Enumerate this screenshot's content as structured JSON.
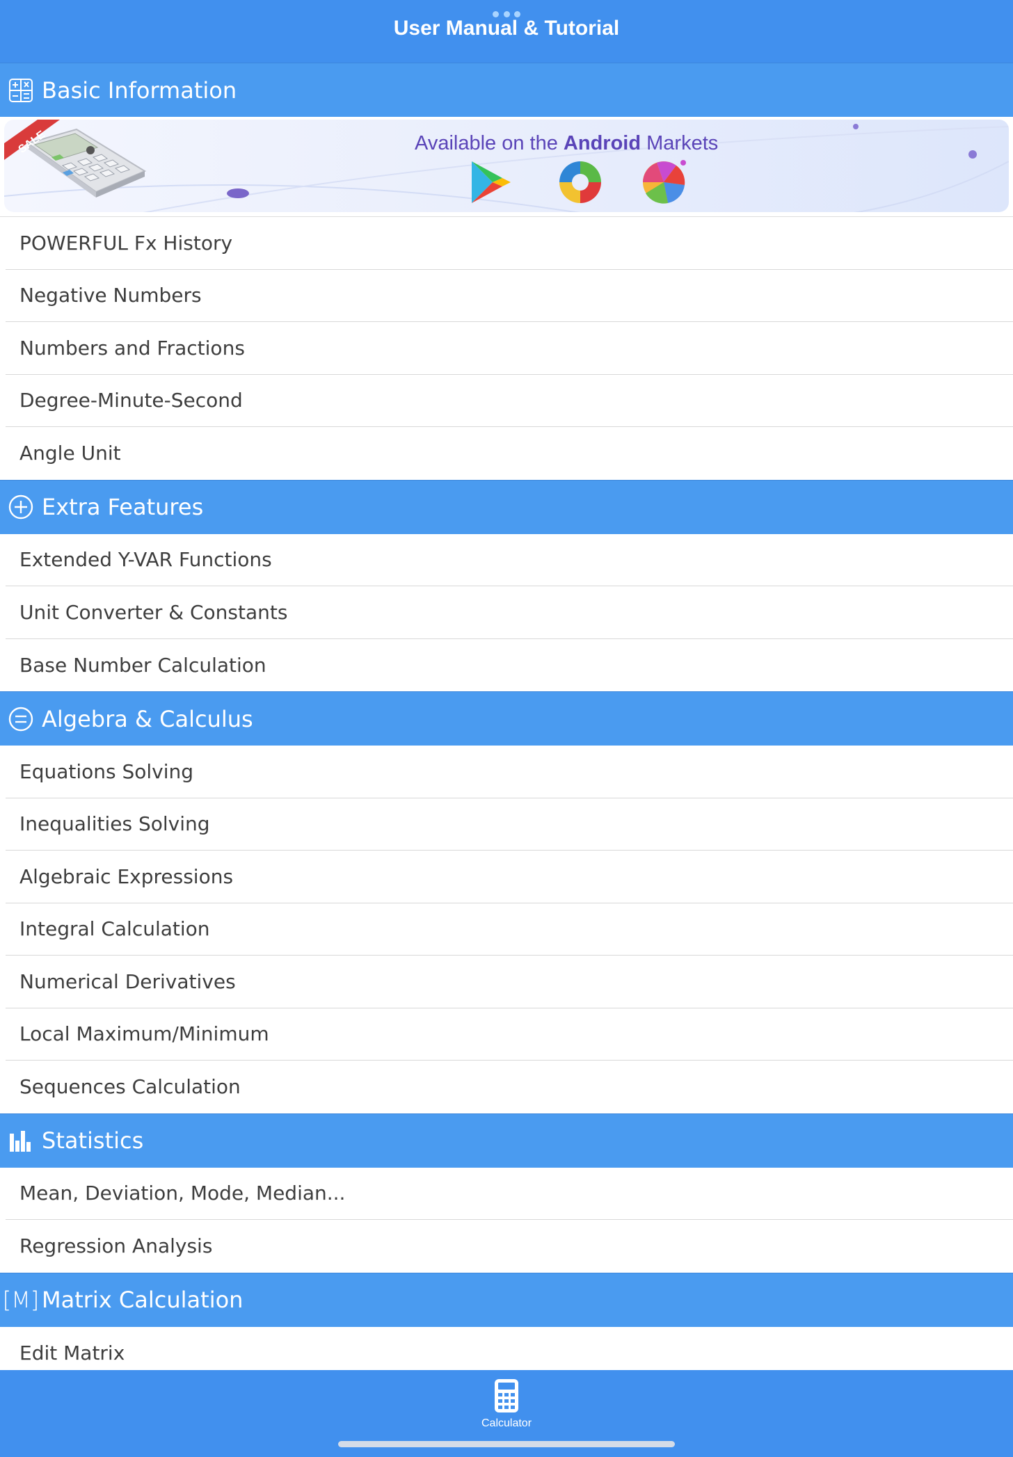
{
  "header": {
    "title": "User Manual & Tutorial"
  },
  "banner": {
    "text_prefix": "Available on the ",
    "text_bold": "Android",
    "text_suffix": " Markets",
    "sale_label": "SALE"
  },
  "sections": [
    {
      "title": "Basic Information",
      "icon": "calculator-grid-icon",
      "items": [
        "POWERFUL Fx History",
        "Negative Numbers",
        "Numbers and Fractions",
        "Degree-Minute-Second",
        "Angle Unit"
      ]
    },
    {
      "title": "Extra Features",
      "icon": "plus-circle-icon",
      "items": [
        "Extended Y-VAR Functions",
        "Unit Converter & Constants",
        "Base Number Calculation"
      ]
    },
    {
      "title": "Algebra & Calculus",
      "icon": "equals-circle-icon",
      "items": [
        "Equations Solving",
        "Inequalities Solving",
        "Algebraic Expressions",
        "Integral Calculation",
        "Numerical Derivatives",
        "Local Maximum/Minimum",
        "Sequences Calculation"
      ]
    },
    {
      "title": "Statistics",
      "icon": "bar-chart-icon",
      "items": [
        "Mean, Deviation, Mode, Median...",
        "Regression Analysis"
      ]
    },
    {
      "title": "Matrix Calculation",
      "icon": "matrix-m-icon",
      "icon_text": "[M]",
      "items": [
        "Edit Matrix"
      ]
    }
  ],
  "tabbar": {
    "label": "Calculator"
  },
  "colors": {
    "header_blue": "#4190ee",
    "section_blue": "#4a9bf0",
    "banner_text": "#5a44b8"
  }
}
